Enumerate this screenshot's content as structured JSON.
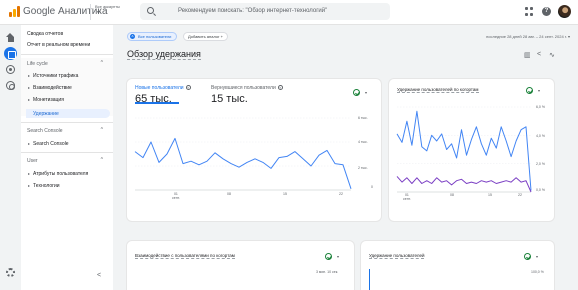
{
  "header": {
    "app_title": "Google Аналитика",
    "account_label": "Все аккаунты",
    "search_placeholder": "Рекомендуем поискать: \"Обзор интернет-технологий\"",
    "help_label": "?"
  },
  "sidebar": {
    "items_top": [
      "Сводка отчетов",
      "Отчет в реальном времени"
    ],
    "sections": [
      {
        "label": "Life cycle",
        "items": [
          "Источники трафика",
          "Взаимодействие",
          "Монетизация"
        ],
        "active": "Удержание"
      },
      {
        "label": "Search Console",
        "items": [
          "Search Console"
        ]
      },
      {
        "label": "User",
        "items": [
          "Атрибуты пользователя",
          "Технологии"
        ]
      }
    ],
    "collapse_icon": "chevron-left-icon"
  },
  "toolbar": {
    "comparison_chip": "Все пользователи",
    "add_comparison": "Добавить аналог +",
    "date_range": "последние 28 дней  28 авг. – 24 сент. 2024 г. ▾"
  },
  "page": {
    "title": "Обзор удержания",
    "icons": [
      "report-icon",
      "share-icon",
      "insights-icon"
    ]
  },
  "card_main": {
    "tab1_label": "Новые пользователи",
    "tab1_value": "65 тыс.",
    "tab2_label": "Вернувшиеся пользователи",
    "tab2_value": "15 тыс.",
    "dropdown": "▾",
    "y_ticks": [
      "6 тыс.",
      "4 тыс.",
      "2 тыс.",
      "0"
    ],
    "x_ticks": [
      {
        "day": "01",
        "month": "сент."
      },
      {
        "day": "08",
        "month": ""
      },
      {
        "day": "15",
        "month": ""
      },
      {
        "day": "22",
        "month": ""
      }
    ]
  },
  "card_cohort": {
    "title": "Удержание пользователей по когортам",
    "dropdown": "▾",
    "y_ticks": [
      "6,0 %",
      "4,0 %",
      "2,0 %",
      "0,0 %"
    ],
    "x_ticks": [
      {
        "day": "01",
        "month": "сент."
      },
      {
        "day": "08",
        "month": ""
      },
      {
        "day": "15",
        "month": ""
      },
      {
        "day": "22",
        "month": ""
      }
    ]
  },
  "card_engagement": {
    "title": "Взаимодействие с пользователями по когортам",
    "dropdown": "▾",
    "y_tick_top": "3 мин. 10 сек."
  },
  "card_retention": {
    "title": "Удержание пользователей",
    "dropdown": "▾",
    "y_tick_top": "100,0 %"
  },
  "colors": {
    "accent": "#1a73e8",
    "series_blue": "#4285f4",
    "series_purple": "#7b3fc4",
    "check_green": "#188038"
  },
  "chart_data": [
    {
      "type": "line",
      "x": [
        "27 авг.",
        "28 авг.",
        "29 авг.",
        "30 авг.",
        "31 авг.",
        "01 сент.",
        "02 сент.",
        "03 сент.",
        "04 сент.",
        "05 сент.",
        "06 сент.",
        "07 сент.",
        "08 сент.",
        "09 сент.",
        "10 сент.",
        "11 сент.",
        "12 сент.",
        "13 сент.",
        "14 сент.",
        "15 сент.",
        "16 сент.",
        "17 сент.",
        "18 сент.",
        "19 сент.",
        "20 сент.",
        "21 сент.",
        "22 сент.",
        "23 сент."
      ],
      "series": [
        {
          "name": "Новые пользователи",
          "values": [
            3200,
            2700,
            4000,
            2300,
            3000,
            4300,
            2200,
            2400,
            2100,
            2400,
            3100,
            2600,
            2200,
            1900,
            2300,
            2600,
            2300,
            1800,
            2700,
            2800,
            3200,
            2600,
            2000,
            2900,
            3300,
            2200,
            2100,
            100
          ]
        }
      ],
      "ylim": [
        0,
        6000
      ],
      "y_ticks": [
        "6 тыс.",
        "4 тыс.",
        "2 тыс.",
        "0"
      ]
    },
    {
      "type": "line",
      "x": [
        "27 авг.",
        "28 авг.",
        "29 авг.",
        "30 авг.",
        "31 авг.",
        "01 сент.",
        "02 сент.",
        "03 сент.",
        "04 сент.",
        "05 сент.",
        "06 сент.",
        "07 сент.",
        "08 сент.",
        "09 сент.",
        "10 сент.",
        "11 сент.",
        "12 сент.",
        "13 сент.",
        "14 сент.",
        "15 сент.",
        "16 сент.",
        "17 сент.",
        "18 сент.",
        "19 сент.",
        "20 сент.",
        "21 сент.",
        "22 сент.",
        "23 сент."
      ],
      "series": [
        {
          "values": [
            4.1,
            3.5,
            5.0,
            3.3,
            5.7,
            3.2,
            2.9,
            4.0,
            3.6,
            4.1,
            3.0,
            3.4,
            2.4,
            4.4,
            2.6,
            3.7,
            4.6,
            3.4,
            2.6,
            3.8,
            3.1,
            4.6,
            3.6,
            2.5,
            3.6,
            4.4,
            4.6,
            0.1
          ]
        },
        {
          "values": [
            1.1,
            0.7,
            1.0,
            0.6,
            1.0,
            0.6,
            0.8,
            0.6,
            1.0,
            0.7,
            0.8,
            0.5,
            0.8,
            0.9,
            0.6,
            0.7,
            0.6,
            0.8,
            0.7,
            0.8,
            0.6,
            0.7,
            0.8,
            0.7,
            1.0,
            0.7,
            0.8,
            0.0
          ]
        }
      ],
      "ylim": [
        0,
        6.0
      ],
      "y_ticks": [
        "6,0 %",
        "4,0 %",
        "2,0 %",
        "0,0 %"
      ]
    }
  ]
}
